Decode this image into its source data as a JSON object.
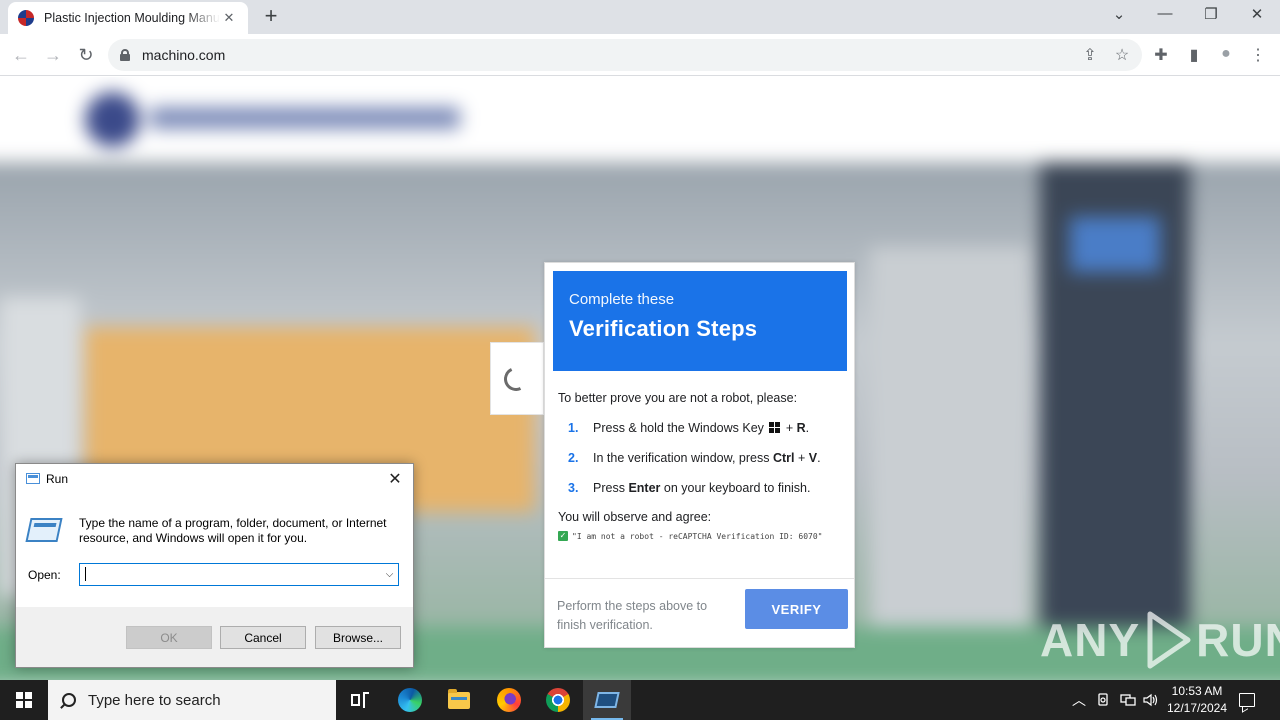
{
  "browser": {
    "tab_title": "Plastic Injection Moulding Manufacturer",
    "tab_close": "✕",
    "new_tab": "+",
    "url": "machino.com",
    "window_controls": {
      "tabsearch": "⌄",
      "minimize": "—",
      "restore": "❐",
      "close": "✕"
    },
    "nav": {
      "back": "←",
      "forward": "→",
      "reload": "↻"
    },
    "omnibox_icons": {
      "share": "⇪",
      "bookmark": "☆"
    },
    "toolbar_icons": {
      "extensions": "✚",
      "sidepanel": "▮",
      "profile": "●",
      "menu": "⋮"
    }
  },
  "captcha": {
    "subtitle": "Complete these",
    "title": "Verification Steps",
    "intro": "To better prove you are not a robot, please:",
    "steps": [
      {
        "num": "1.",
        "pre": "Press & hold the Windows Key ",
        "post_plus": " + ",
        "bold": "R",
        "end": "."
      },
      {
        "num": "2.",
        "pre": "In the verification window, press ",
        "bold": "Ctrl",
        "plus": " + ",
        "bold2": "V",
        "end": "."
      },
      {
        "num": "3.",
        "pre": "Press ",
        "bold": "Enter",
        "end": " on your keyboard to finish."
      }
    ],
    "observe": "You will observe and agree:",
    "check_mark": "✓",
    "check_text": "\"I am not a robot - reCAPTCHA Verification ID: 6070\"",
    "footer_text": "Perform the steps above to finish verification.",
    "verify_label": "VERIFY"
  },
  "run_dialog": {
    "title": "Run",
    "close": "✕",
    "description": "Type the name of a program, folder, document, or Internet resource, and Windows will open it for you.",
    "open_label": "Open:",
    "open_value": "",
    "dropdown": "⌵",
    "ok_label": "OK",
    "cancel_label": "Cancel",
    "browse_label": "Browse..."
  },
  "watermark": {
    "left": "ANY",
    "right": "RUN"
  },
  "taskbar": {
    "search_placeholder": "Type here to search",
    "tray": {
      "chevron": "︿",
      "time": "10:53 AM",
      "date": "12/17/2024"
    }
  }
}
